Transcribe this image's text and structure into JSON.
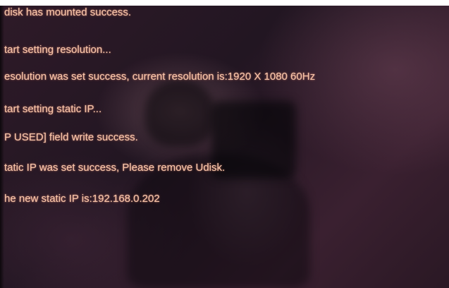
{
  "top_caption": "",
  "console": {
    "lines": [
      "disk has mounted success.",
      "tart setting resolution...",
      "esolution was set success, current resolution is:1920 X 1080   60Hz",
      "tart setting static IP...",
      "P USED] field write success.",
      "tatic IP was set success, Please remove Udisk.",
      "he new static IP is:192.168.0.202"
    ],
    "text_color": "#f4c2a6",
    "background_color": "#2a1824"
  }
}
